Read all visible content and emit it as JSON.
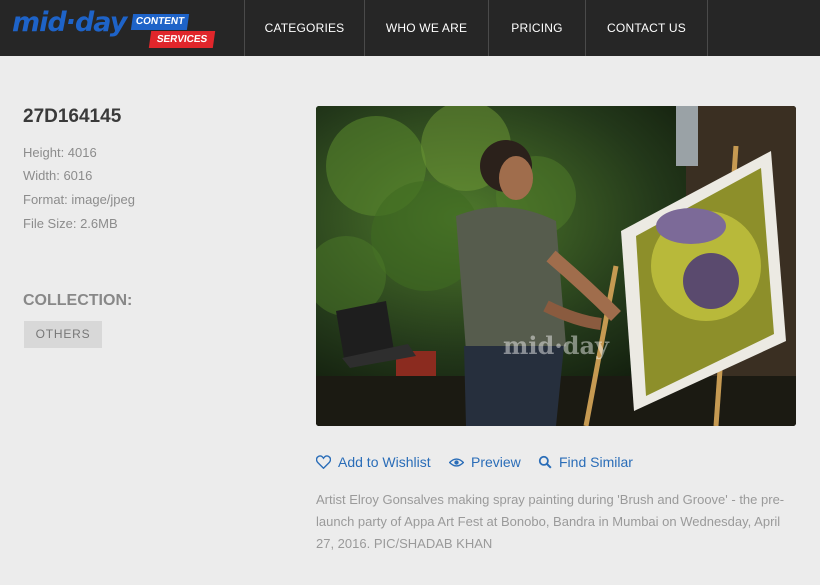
{
  "logo": {
    "brand": "mid·day",
    "sub_top": "CONTENT",
    "sub_bottom": "SERVICES"
  },
  "nav": {
    "items": [
      {
        "label": "CATEGORIES"
      },
      {
        "label": "WHO WE ARE"
      },
      {
        "label": "PRICING"
      },
      {
        "label": "CONTACT US"
      }
    ]
  },
  "image": {
    "id": "27D164145",
    "height": "Height: 4016",
    "width": "Width: 6016",
    "format": "Format: image/jpeg",
    "file_size": "File Size: 2.6MB",
    "watermark": "mid·day"
  },
  "collection": {
    "title": "COLLECTION:",
    "tag": "OTHERS"
  },
  "actions": {
    "wishlist": "Add to Wishlist",
    "preview": "Preview",
    "find_similar": "Find Similar"
  },
  "caption": "Artist Elroy Gonsalves making spray painting during 'Brush and Groove' - the pre-launch party of Appa Art Fest at Bonobo, Bandra in Mumbai on Wednesday, April 27, 2016. PIC/SHADAB KHAN",
  "colors": {
    "nav_bg": "#262626",
    "brand_blue": "#1e63c8",
    "brand_red": "#e0262b",
    "link": "#2a6db8",
    "page_bg": "#ececec"
  }
}
